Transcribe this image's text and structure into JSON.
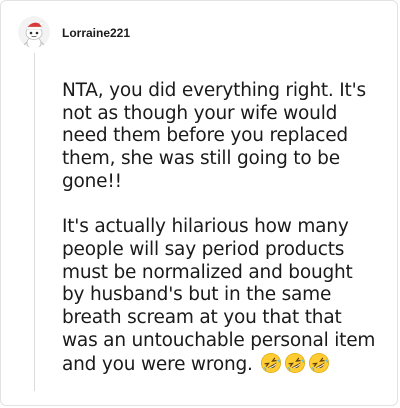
{
  "comment": {
    "username": "Lorraine221",
    "paragraphs": [
      "NTA, you did everything right. It's not as though your wife would need them before you replaced them, she was still going to be gone!!",
      "It's actually hilarious how many people will say period products must be normalized and bought by husband's but in the same breath scream at you that that was an untouchable personal item and you were wrong."
    ],
    "emoji_count": 3,
    "emoji_icon": "rolling-on-floor-laughing-emoji"
  },
  "colors": {
    "text": "#1a1a1b",
    "border": "#e3e3e3",
    "thread_line": "#dcdcdc",
    "avatar_hat": "#d93a3a"
  }
}
